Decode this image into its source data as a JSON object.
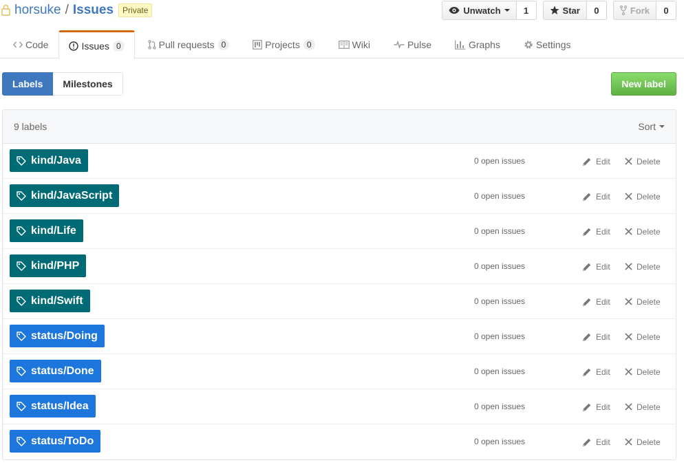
{
  "repo": {
    "owner": "horsuke",
    "separator": "/",
    "name": "Issues",
    "visibility": "Private"
  },
  "actions": {
    "watch": {
      "label": "Unwatch",
      "count": "1"
    },
    "star": {
      "label": "Star",
      "count": "0"
    },
    "fork": {
      "label": "Fork",
      "count": "0"
    }
  },
  "nav": {
    "code": "Code",
    "issues": {
      "label": "Issues",
      "count": "0"
    },
    "pulls": {
      "label": "Pull requests",
      "count": "0"
    },
    "projects": {
      "label": "Projects",
      "count": "0"
    },
    "wiki": "Wiki",
    "pulse": "Pulse",
    "graphs": "Graphs",
    "settings": "Settings"
  },
  "subnav": {
    "labels": "Labels",
    "milestones": "Milestones",
    "new_label": "New label"
  },
  "table": {
    "count_text": "9 labels",
    "sort_label": "Sort",
    "edit_label": "Edit",
    "delete_label": "Delete",
    "rows": [
      {
        "name": "kind/Java",
        "color": "#006b75",
        "issues": "0 open issues"
      },
      {
        "name": "kind/JavaScript",
        "color": "#006b75",
        "issues": "0 open issues"
      },
      {
        "name": "kind/Life",
        "color": "#006b75",
        "issues": "0 open issues"
      },
      {
        "name": "kind/PHP",
        "color": "#006b75",
        "issues": "0 open issues"
      },
      {
        "name": "kind/Swift",
        "color": "#006b75",
        "issues": "0 open issues"
      },
      {
        "name": "status/Doing",
        "color": "#1d76db",
        "issues": "0 open issues"
      },
      {
        "name": "status/Done",
        "color": "#1d76db",
        "issues": "0 open issues"
      },
      {
        "name": "status/Idea",
        "color": "#1d76db",
        "issues": "0 open issues"
      },
      {
        "name": "status/ToDo",
        "color": "#1d76db",
        "issues": "0 open issues"
      }
    ]
  },
  "colors": {
    "link": "#4078c0",
    "active_tab_border": "#d26911",
    "new_label_green": "#60b044",
    "kind_label": "#006b75",
    "status_label": "#1d76db"
  }
}
